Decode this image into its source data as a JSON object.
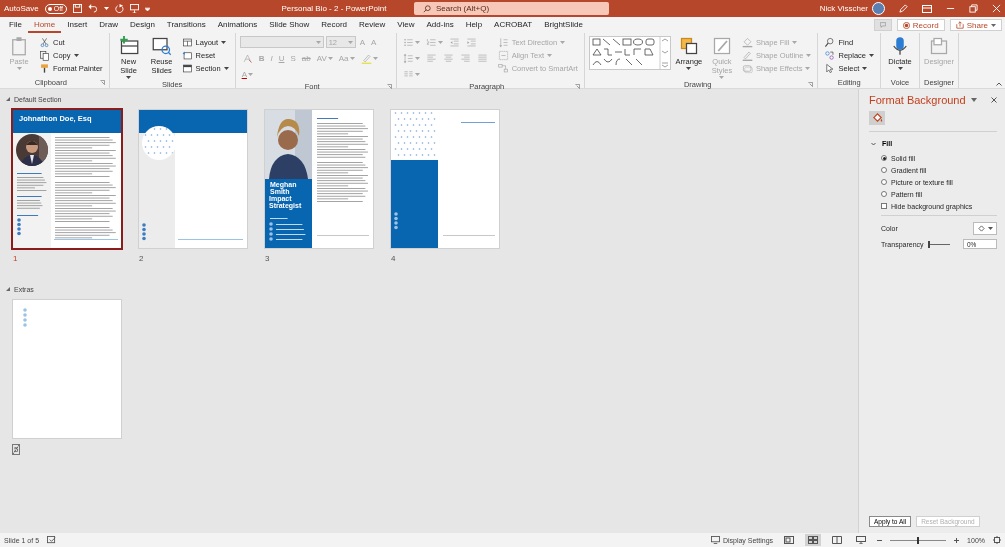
{
  "title_bar": {
    "autosave_label": "AutoSave",
    "autosave_toggle": {
      "label": "Off",
      "on": false
    },
    "document_title": "Personal Bio  -  2  -  PowerPoint",
    "search": {
      "placeholder": "Search (Alt+Q)"
    },
    "user_name": "Nick Visscher"
  },
  "menu_tabs": [
    {
      "label": "File",
      "selected": false
    },
    {
      "label": "Home",
      "selected": true
    },
    {
      "label": "Insert",
      "selected": false
    },
    {
      "label": "Draw",
      "selected": false
    },
    {
      "label": "Design",
      "selected": false
    },
    {
      "label": "Transitions",
      "selected": false
    },
    {
      "label": "Animations",
      "selected": false
    },
    {
      "label": "Slide Show",
      "selected": false
    },
    {
      "label": "Record",
      "selected": false
    },
    {
      "label": "Review",
      "selected": false
    },
    {
      "label": "View",
      "selected": false
    },
    {
      "label": "Add-ins",
      "selected": false
    },
    {
      "label": "Help",
      "selected": false
    },
    {
      "label": "ACROBAT",
      "selected": false
    },
    {
      "label": "BrightSlide",
      "selected": false
    }
  ],
  "tab_bar_buttons": [
    {
      "kind": "comments"
    },
    {
      "kind": "record",
      "label": "Record"
    },
    {
      "kind": "share",
      "label": "Share"
    }
  ],
  "ribbon": {
    "groups": [
      {
        "name": "Clipboard",
        "launcher": true,
        "items": [
          {
            "kind": "paste",
            "label": "Paste",
            "disabled": true,
            "dropdown": true
          },
          {
            "kind": "cut",
            "label": "Cut",
            "disabled": false
          },
          {
            "kind": "copy",
            "label": "Copy",
            "disabled": false,
            "dropdown": true
          },
          {
            "kind": "format_painter",
            "label": "Format Painter",
            "disabled": false
          }
        ]
      },
      {
        "name": "Slides",
        "items": [
          {
            "kind": "new_slide",
            "label": "New Slide",
            "disabled": false,
            "dropdown": true
          },
          {
            "kind": "reuse_slides",
            "label": "Reuse Slides",
            "disabled": false
          },
          {
            "kind": "layout",
            "label": "Layout",
            "disabled": false,
            "dropdown": true
          },
          {
            "kind": "reset",
            "label": "Reset",
            "disabled": false
          },
          {
            "kind": "section",
            "label": "Section",
            "disabled": false,
            "dropdown": true
          }
        ]
      },
      {
        "name": "Font",
        "launcher": true,
        "items": [
          {
            "kind": "font_name",
            "disabled": true,
            "dropdown": true
          },
          {
            "kind": "font_size",
            "value": "12",
            "disabled": true,
            "dropdown": true
          },
          {
            "kind": "grow",
            "label": "A",
            "disabled": true
          },
          {
            "kind": "shrink",
            "label": "A",
            "disabled": true
          },
          {
            "kind": "clear_formatting",
            "disabled": true
          },
          {
            "kind": "bold",
            "label": "B",
            "disabled": true
          },
          {
            "kind": "italic",
            "label": "I",
            "disabled": true
          },
          {
            "kind": "underline",
            "label": "U",
            "disabled": true
          },
          {
            "kind": "shadow",
            "label": "S",
            "disabled": true
          },
          {
            "kind": "strikethrough",
            "label": "ab",
            "disabled": true
          },
          {
            "kind": "spacing",
            "label": "AV",
            "disabled": true,
            "dropdown": true
          },
          {
            "kind": "case",
            "label": "Aa",
            "disabled": true,
            "dropdown": true
          },
          {
            "kind": "highlight",
            "disabled": true,
            "dropdown": true
          },
          {
            "kind": "font_color",
            "label": "A",
            "disabled": true,
            "dropdown": true
          }
        ]
      },
      {
        "name": "Paragraph",
        "launcher": true,
        "items": [
          {
            "kind": "bullets",
            "disabled": true,
            "dropdown": true
          },
          {
            "kind": "numbering",
            "disabled": true,
            "dropdown": true
          },
          {
            "kind": "decrease_indent",
            "disabled": true
          },
          {
            "kind": "increase_indent",
            "disabled": true
          },
          {
            "kind": "line_spacing",
            "disabled": true,
            "dropdown": true
          },
          {
            "kind": "align_left",
            "disabled": true
          },
          {
            "kind": "center",
            "disabled": true
          },
          {
            "kind": "align_right",
            "disabled": true
          },
          {
            "kind": "justify",
            "disabled": true
          },
          {
            "kind": "columns",
            "disabled": true,
            "dropdown": true
          },
          {
            "kind": "text_direction",
            "label": "Text Direction",
            "disabled": true,
            "dropdown": true
          },
          {
            "kind": "align_text",
            "label": "Align Text",
            "disabled": true,
            "dropdown": true
          },
          {
            "kind": "smartart",
            "label": "Convert to SmartArt",
            "disabled": true
          }
        ]
      },
      {
        "name": "Drawing",
        "launcher": true,
        "items": [
          {
            "kind": "shapes_gallery",
            "disabled": false
          },
          {
            "kind": "arrange",
            "label": "Arrange",
            "disabled": false,
            "dropdown": true
          },
          {
            "kind": "quick_styles",
            "label": "Quick Styles",
            "disabled": true,
            "dropdown": true
          },
          {
            "kind": "shape_fill",
            "label": "Shape Fill",
            "disabled": true,
            "dropdown": true
          },
          {
            "kind": "shape_outline",
            "label": "Shape Outline",
            "disabled": true,
            "dropdown": true
          },
          {
            "kind": "shape_effects",
            "label": "Shape Effects",
            "disabled": true,
            "dropdown": true
          }
        ]
      },
      {
        "name": "Editing",
        "items": [
          {
            "kind": "find",
            "label": "Find",
            "disabled": false
          },
          {
            "kind": "replace",
            "label": "Replace",
            "disabled": false,
            "dropdown": true
          },
          {
            "kind": "select",
            "label": "Select",
            "disabled": false,
            "dropdown": true
          }
        ]
      },
      {
        "name": "Voice",
        "items": [
          {
            "kind": "dictate",
            "label": "Dictate",
            "disabled": false,
            "dropdown": true
          }
        ]
      },
      {
        "name": "Designer",
        "items": [
          {
            "kind": "designer",
            "label": "Designer",
            "disabled": true
          }
        ]
      }
    ]
  },
  "slide_sections": [
    {
      "name": "Default Section",
      "expanded": true,
      "slides": [
        {
          "number": "1",
          "kind": "profile",
          "selected": true,
          "hidden": false,
          "heading": "Johnathon Doe, Esq"
        },
        {
          "number": "2",
          "kind": "header_dots",
          "selected": false,
          "hidden": false
        },
        {
          "number": "3",
          "kind": "photo_column",
          "selected": false,
          "hidden": false,
          "heading": "Meghan Smith",
          "subheading": "Impact Strategist"
        },
        {
          "number": "4",
          "kind": "pattern_column",
          "selected": false,
          "hidden": false
        }
      ]
    },
    {
      "name": "Extras",
      "expanded": true,
      "slides": [
        {
          "number": "5",
          "kind": "bullets",
          "selected": false,
          "hidden": true
        }
      ]
    }
  ],
  "format_pane": {
    "title": "Format Background",
    "fill_section": {
      "title": "Fill",
      "expanded": true,
      "options": [
        {
          "label": "Solid fill",
          "selected": true
        },
        {
          "label": "Gradient fill",
          "selected": false
        },
        {
          "label": "Picture or texture fill",
          "selected": false
        },
        {
          "label": "Pattern fill",
          "selected": false
        }
      ],
      "hide_background_graphics": {
        "label": "Hide background graphics",
        "checked": false
      },
      "color_label": "Color",
      "transparency": {
        "label": "Transparency",
        "level": 0,
        "value": "0%"
      }
    },
    "buttons": [
      {
        "label": "Apply to All",
        "disabled": false
      },
      {
        "label": "Reset Background",
        "disabled": true
      }
    ]
  },
  "status_bar": {
    "slide_info": "Slide 1 of 5",
    "display_settings": "Display Settings",
    "views": [
      {
        "kind": "normal",
        "selected": false
      },
      {
        "kind": "sorter",
        "selected": true
      },
      {
        "kind": "reading",
        "selected": false
      },
      {
        "kind": "slideshow",
        "selected": false
      }
    ],
    "zoom": {
      "level": 0.5,
      "value": "100%"
    }
  }
}
